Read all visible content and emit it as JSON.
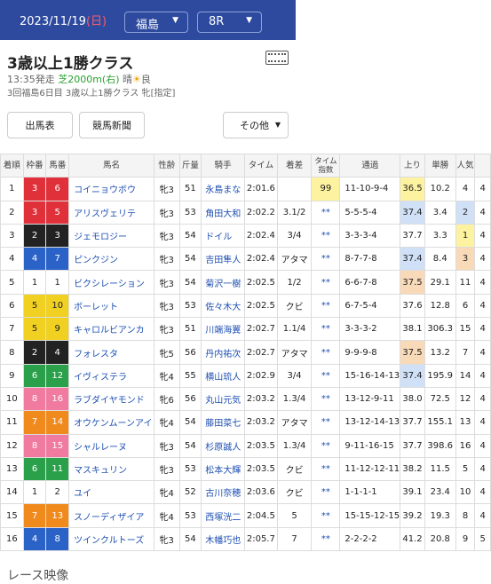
{
  "header": {
    "date": "2023/11/19",
    "weekday": "(日)",
    "course": "福島",
    "race": "8R"
  },
  "race": {
    "title": "3歳以上1勝クラス",
    "start": "13:35発走",
    "distance": "芝2000m(右)",
    "weather": "晴",
    "weather_icon": "sun-icon",
    "ground": "良",
    "meta": "3回福島6日目 3歳以上1勝クラス 牝[指定]"
  },
  "buttons": {
    "entries": "出馬表",
    "newspaper": "競馬新聞",
    "more": "その他"
  },
  "table": {
    "headers": [
      "着順",
      "枠番",
      "馬番",
      "馬名",
      "性齢",
      "斤量",
      "騎手",
      "タイム",
      "着差",
      "タイム指数",
      "通過",
      "上り",
      "単勝",
      "人気",
      ""
    ],
    "rows": [
      [
        "1",
        "3",
        "6",
        "コイニョウボウ",
        "牝3",
        "51",
        "永島まな",
        "2:01.6",
        "",
        "99",
        "11-10-9-4",
        "36.5",
        "10.2",
        "4",
        "4"
      ],
      [
        "2",
        "3",
        "5",
        "アリスヴェリテ",
        "牝3",
        "53",
        "角田大和",
        "2:02.2",
        "3.1/2",
        "**",
        "5-5-5-4",
        "37.4",
        "3.4",
        "2",
        "4"
      ],
      [
        "3",
        "2",
        "3",
        "ジェモロジー",
        "牝3",
        "54",
        "ドイル",
        "2:02.4",
        "3/4",
        "**",
        "3-3-3-4",
        "37.7",
        "3.3",
        "1",
        "4"
      ],
      [
        "4",
        "4",
        "7",
        "ピンクジン",
        "牝3",
        "54",
        "吉田隼人",
        "2:02.4",
        "アタマ",
        "**",
        "8-7-7-8",
        "37.4",
        "8.4",
        "3",
        "4"
      ],
      [
        "5",
        "1",
        "1",
        "ビクシレーション",
        "牝3",
        "54",
        "菊沢一樹",
        "2:02.5",
        "1/2",
        "**",
        "6-6-7-8",
        "37.5",
        "29.1",
        "11",
        "4"
      ],
      [
        "6",
        "5",
        "10",
        "ボーレット",
        "牝3",
        "53",
        "佐々木大",
        "2:02.5",
        "クビ",
        "**",
        "6-7-5-4",
        "37.6",
        "12.8",
        "6",
        "4"
      ],
      [
        "7",
        "5",
        "9",
        "キャロルビアンカ",
        "牝3",
        "51",
        "川端海翼",
        "2:02.7",
        "1.1/4",
        "**",
        "3-3-3-2",
        "38.1",
        "306.3",
        "15",
        "4"
      ],
      [
        "8",
        "2",
        "4",
        "フォレスタ",
        "牝5",
        "56",
        "丹内祐次",
        "2:02.7",
        "アタマ",
        "**",
        "9-9-9-8",
        "37.5",
        "13.2",
        "7",
        "4"
      ],
      [
        "9",
        "6",
        "12",
        "イヴィステラ",
        "牝4",
        "55",
        "横山琉人",
        "2:02.9",
        "3/4",
        "**",
        "15-16-14-13",
        "37.4",
        "195.9",
        "14",
        "4"
      ],
      [
        "10",
        "8",
        "16",
        "ラブダイヤモンド",
        "牝6",
        "56",
        "丸山元気",
        "2:03.2",
        "1.3/4",
        "**",
        "13-12-9-11",
        "38.0",
        "72.5",
        "12",
        "4"
      ],
      [
        "11",
        "7",
        "14",
        "オウケンムーンアイ",
        "牝4",
        "54",
        "藤田菜七",
        "2:03.2",
        "アタマ",
        "**",
        "13-12-14-13",
        "37.7",
        "155.1",
        "13",
        "4"
      ],
      [
        "12",
        "8",
        "15",
        "シャルレーヌ",
        "牝3",
        "54",
        "杉原誠人",
        "2:03.5",
        "1.3/4",
        "**",
        "9-11-16-15",
        "37.7",
        "398.6",
        "16",
        "4"
      ],
      [
        "13",
        "6",
        "11",
        "マスキュリン",
        "牝3",
        "53",
        "松本大輝",
        "2:03.5",
        "クビ",
        "**",
        "11-12-12-11",
        "38.2",
        "11.5",
        "5",
        "4"
      ],
      [
        "14",
        "1",
        "2",
        "ユイ",
        "牝4",
        "52",
        "古川奈穂",
        "2:03.6",
        "クビ",
        "**",
        "1-1-1-1",
        "39.1",
        "23.4",
        "10",
        "4"
      ],
      [
        "15",
        "7",
        "13",
        "スノーディザイア",
        "牝4",
        "53",
        "西塚洸二",
        "2:04.5",
        "5",
        "**",
        "15-15-12-15",
        "39.2",
        "19.3",
        "8",
        "4"
      ],
      [
        "16",
        "4",
        "8",
        "ツインクルトーズ",
        "牝3",
        "54",
        "木幡巧也",
        "2:05.7",
        "7",
        "**",
        "2-2-2-2",
        "41.2",
        "20.8",
        "9",
        "5"
      ]
    ]
  },
  "section_title": "レース映像",
  "colors": {
    "header_bg": "#2d4a9e",
    "waku": {
      "1": "#ffffff",
      "2": "#222222",
      "3": "#e0303a",
      "4": "#2a62c8",
      "5": "#f0d020",
      "6": "#2aa04a",
      "7": "#f08a1c",
      "8": "#f07aa0"
    }
  }
}
